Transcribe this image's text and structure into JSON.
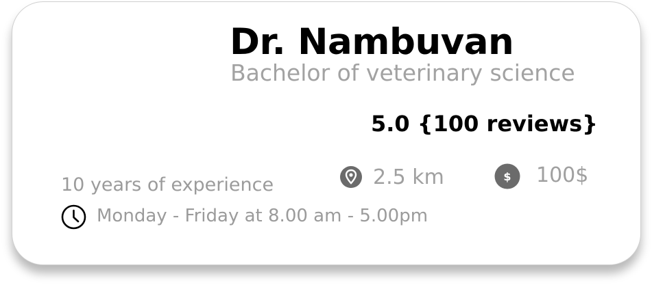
{
  "doctor": {
    "name": "Dr. Nambuvan",
    "degree": "Bachelor of veterinary science",
    "rating": "5.0 {100 reviews}",
    "experience": "10 years of experience",
    "distance": "2.5 km",
    "price": "100$",
    "hours": "Monday - Friday at 8.00 am - 5.00pm"
  },
  "icons": {
    "distance": "location-pin-icon",
    "price": "dollar-coin-icon",
    "hours": "clock-icon"
  },
  "colors": {
    "primary_text": "#000000",
    "secondary_text": "#a0a0a0",
    "icon_fill": "#6b6b6b"
  }
}
